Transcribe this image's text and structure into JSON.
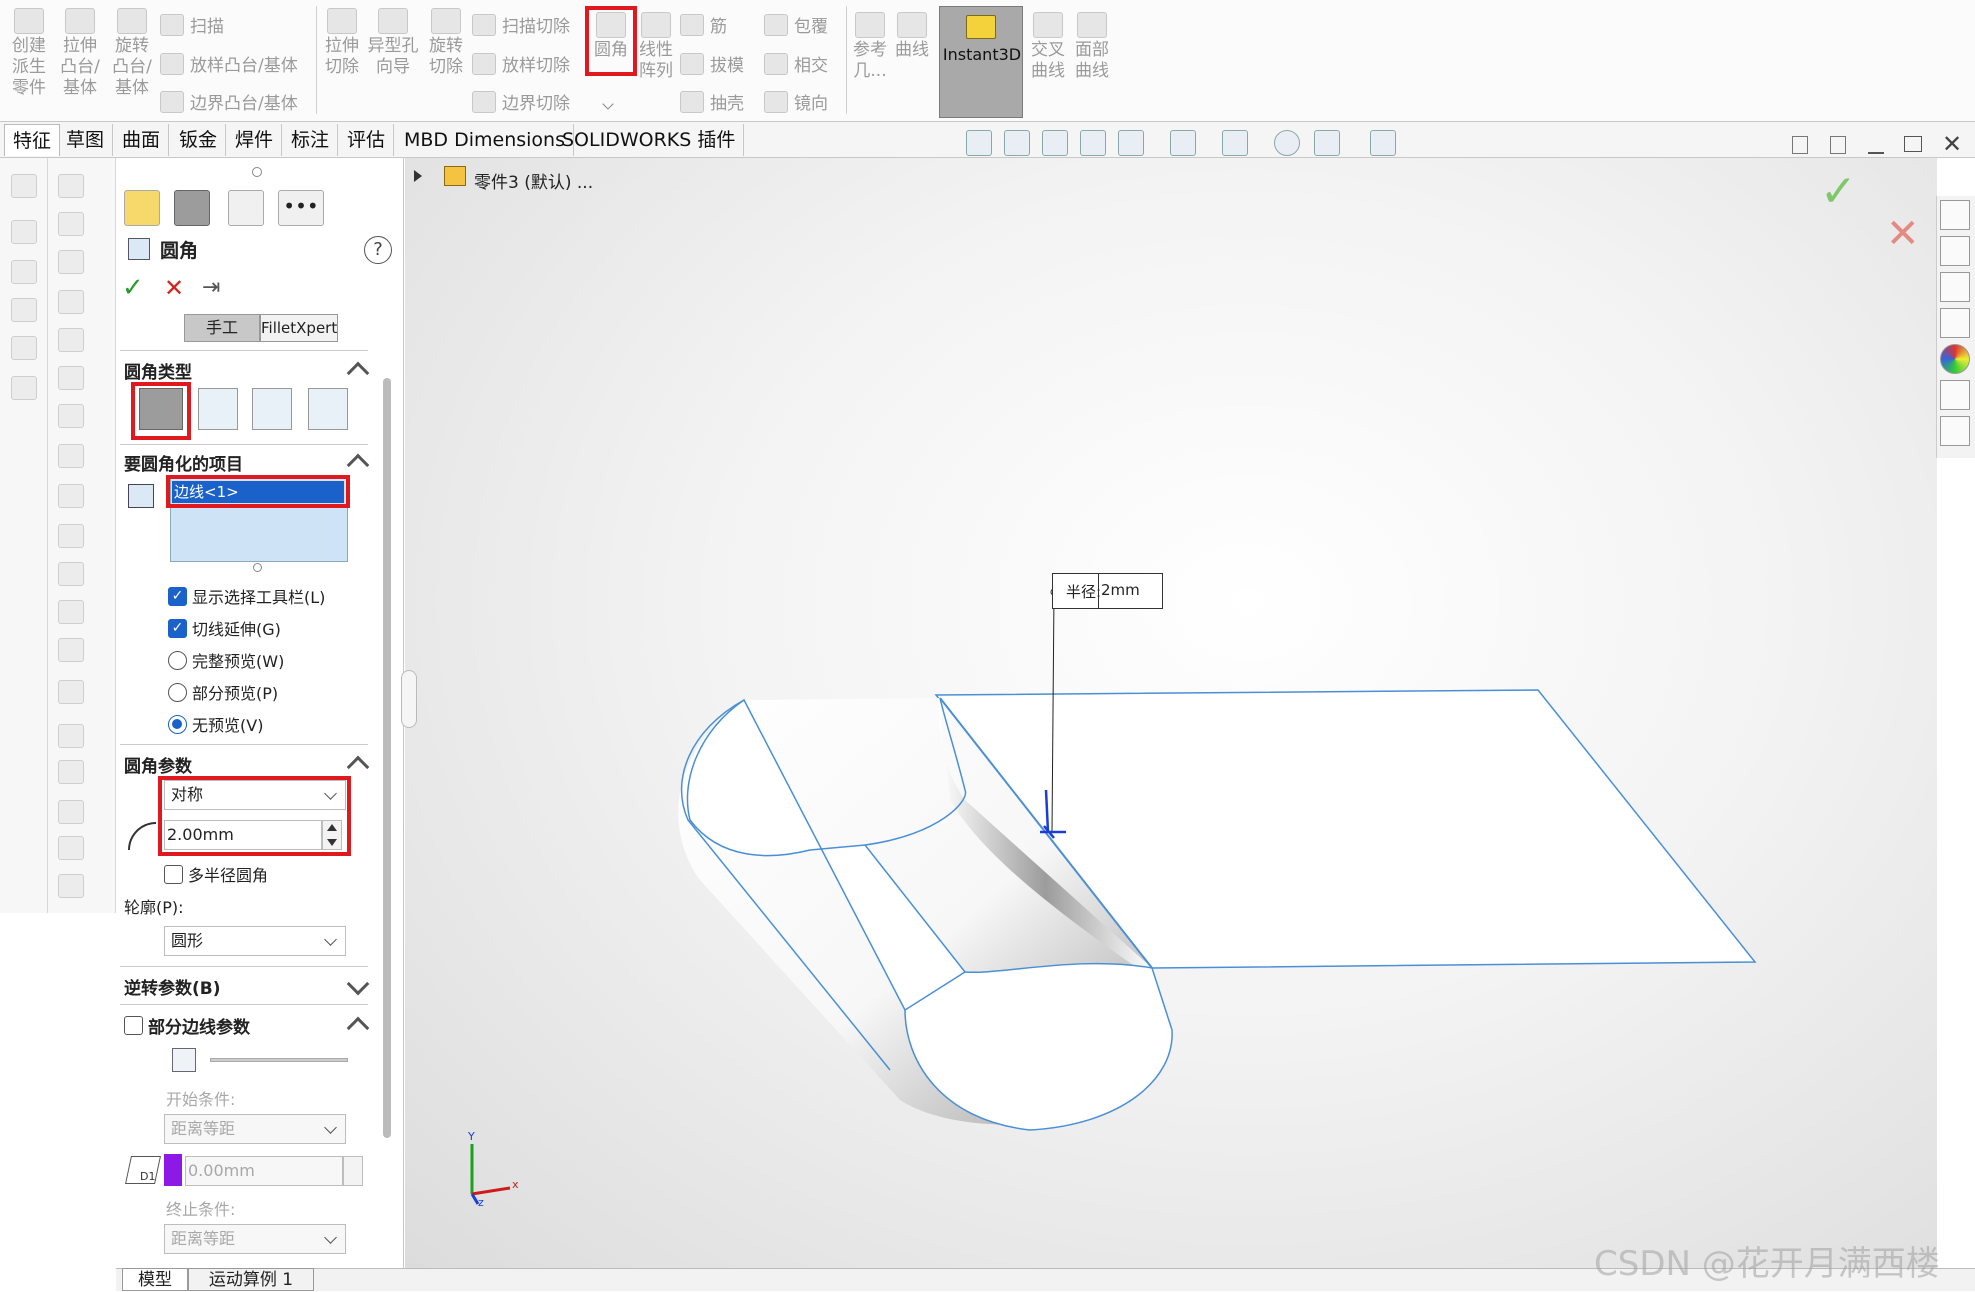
{
  "ribbon": {
    "features": [
      {
        "id": "extrude-derived",
        "lines": [
          "创建",
          "派生",
          "零件"
        ]
      },
      {
        "id": "extrude-boss",
        "lines": [
          "拉伸",
          "凸台/",
          "基体"
        ]
      },
      {
        "id": "revolve-boss",
        "lines": [
          "旋转",
          "凸台/",
          "基体"
        ]
      },
      {
        "id": "extrude-cut",
        "lines": [
          "拉伸",
          "切除"
        ]
      },
      {
        "id": "hole-wizard",
        "lines": [
          "异型孔",
          "向导"
        ]
      },
      {
        "id": "revolve-cut",
        "lines": [
          "旋转",
          "切除"
        ]
      },
      {
        "id": "fillet",
        "lines": [
          "圆角"
        ]
      },
      {
        "id": "linear-pattern",
        "lines": [
          "线性",
          "阵列"
        ]
      },
      {
        "id": "ref-geometry",
        "lines": [
          "参考",
          "几..."
        ]
      },
      {
        "id": "curves",
        "lines": [
          "曲线"
        ]
      },
      {
        "id": "intersect-curve",
        "lines": [
          "交叉",
          "曲线"
        ]
      },
      {
        "id": "face-curve",
        "lines": [
          "面部",
          "曲线"
        ]
      }
    ],
    "sweep": "扫描",
    "loft_boss": "放样凸台/基体",
    "boundary_boss": "边界凸台/基体",
    "sweep_cut": "扫描切除",
    "loft_cut": "放样切除",
    "boundary_cut": "边界切除",
    "rib": "筋",
    "draft": "拔模",
    "shell": "抽壳",
    "wrap": "包覆",
    "intersect": "相交",
    "mirror": "镜向",
    "instant3d": "Instant3D"
  },
  "tabs": [
    "特征",
    "草图",
    "曲面",
    "钣金",
    "焊件",
    "标注",
    "评估",
    "MBD Dimensions",
    "SOLIDWORKS 插件"
  ],
  "tree": {
    "part_name": "零件3 (默认) ..."
  },
  "panel": {
    "title": "圆角",
    "help": "?",
    "mode_manual": "手工",
    "mode_xpert": "FilletXpert",
    "fillet_type_title": "圆角类型",
    "items_title": "要圆角化的项目",
    "selected_item": "边线<1>",
    "show_toolbar": "显示选择工具栏(L)",
    "tangent_prop": "切线延伸(G)",
    "full_preview": "完整预览(W)",
    "partial_preview": "部分预览(P)",
    "no_preview": "无预览(V)",
    "params_title": "圆角参数",
    "symmetric": "对称",
    "radius": "2.00mm",
    "multi_radius": "多半径圆角",
    "profile_label": "轮廓(P):",
    "profile_value": "圆形",
    "reverse_title": "逆转参数(B)",
    "partial_edge_title": "部分边线参数",
    "start_condition": "开始条件:",
    "start_value": "距离等距",
    "offset_value": "0.00mm",
    "end_condition": "终止条件:",
    "end_value": "距离等距",
    "d1": "D1"
  },
  "viewport": {
    "radius_callout": "半径:",
    "radius_value": "2mm",
    "axis_x": "x",
    "axis_y": "Y",
    "axis_z": "z"
  },
  "bottom_tabs": [
    "模型",
    "运动算例 1"
  ],
  "watermark": "CSDN @花开月满西楼",
  "colors": {
    "accent_red": "#e0191f",
    "select_blue": "#1a62c9",
    "edge_blue": "#4a8fd6"
  }
}
